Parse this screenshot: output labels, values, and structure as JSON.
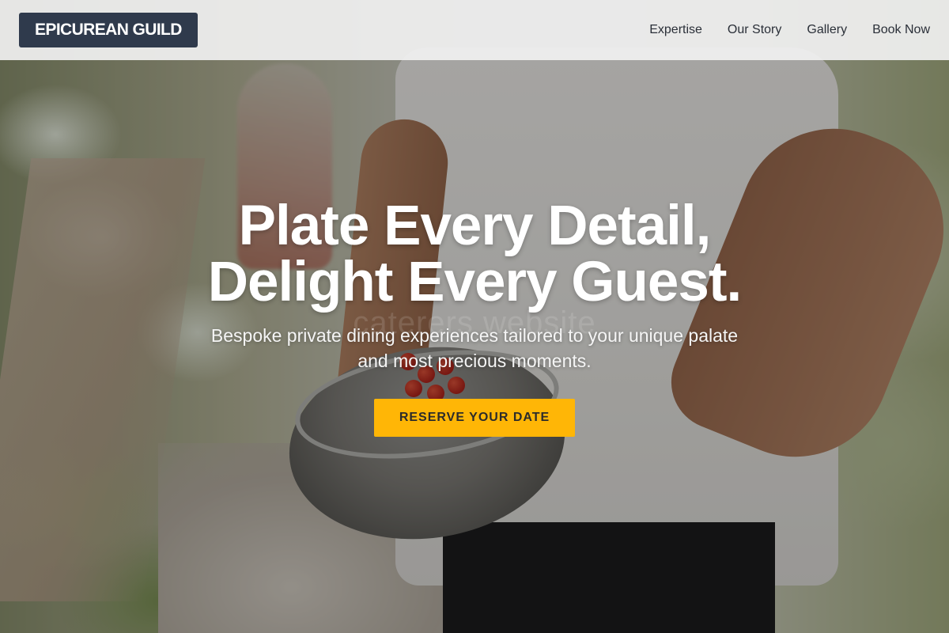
{
  "navbar": {
    "brand": "EPICUREAN GUILD",
    "links": [
      {
        "label": "Expertise"
      },
      {
        "label": "Our Story"
      },
      {
        "label": "Gallery"
      },
      {
        "label": "Book Now"
      }
    ]
  },
  "hero": {
    "headline_line1": "Plate Every Detail,",
    "headline_line2": "Delight Every Guest.",
    "subheadline": "Bespoke private dining experiences tailored to your unique palate and most precious moments.",
    "cta_label": "RESERVE YOUR DATE",
    "watermark": "caterers website"
  },
  "colors": {
    "brand_background": "#2f3a4c",
    "cta_background": "#ffb606",
    "navbar_background": "#f0f0f0",
    "headline_text": "#ffffff"
  }
}
